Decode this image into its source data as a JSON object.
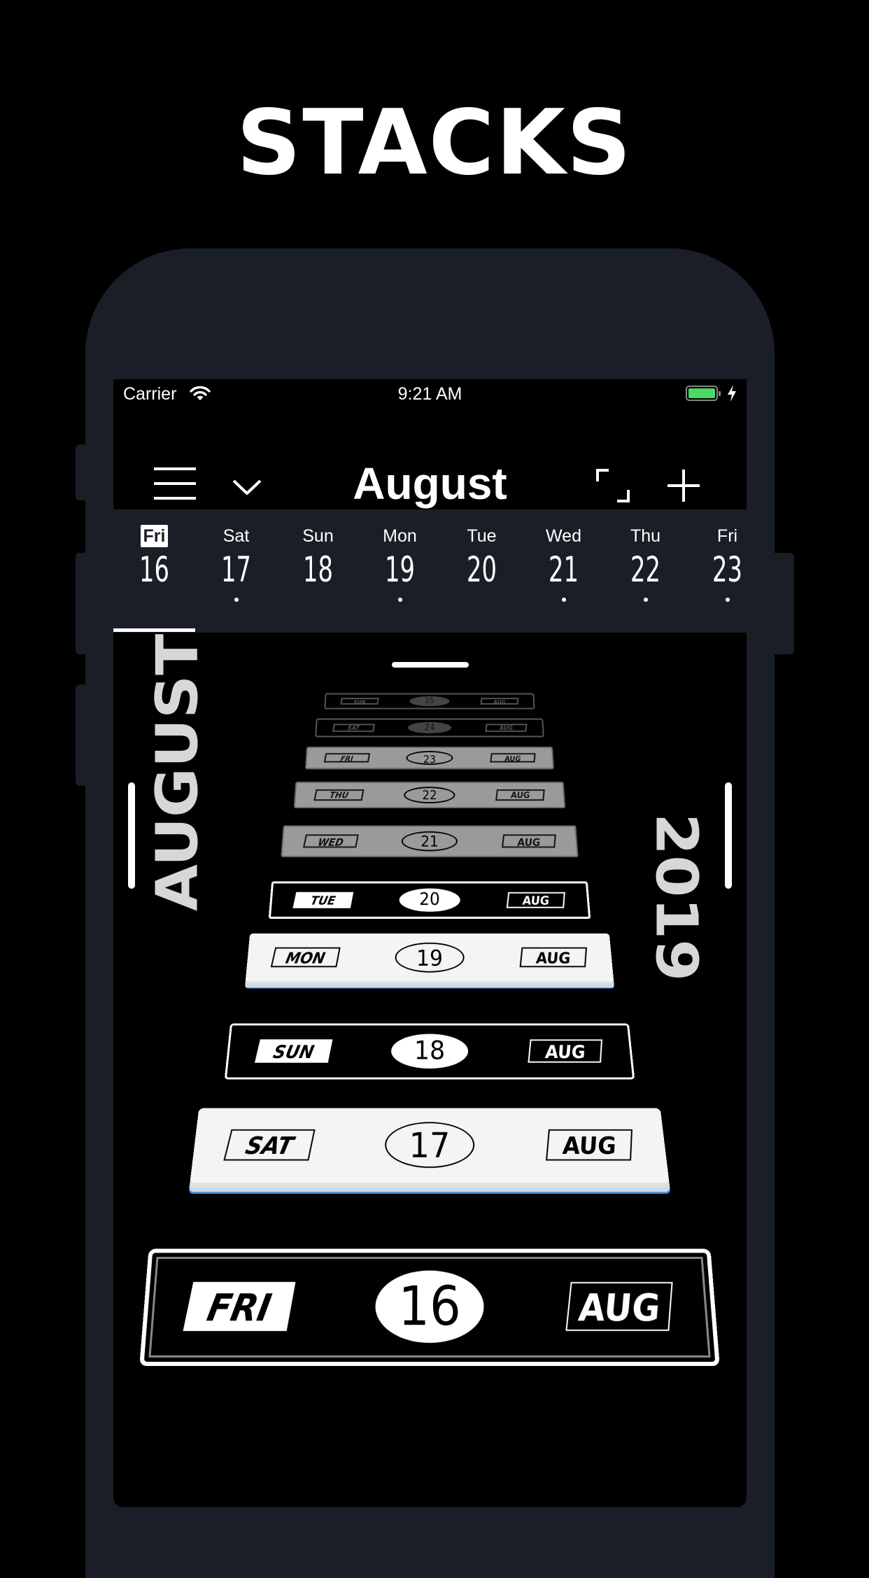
{
  "headline": "STACKS",
  "status": {
    "carrier": "Carrier",
    "time": "9:21 AM"
  },
  "nav": {
    "title": "August",
    "icons": [
      "menu-icon",
      "chevron-down-icon",
      "expand-icon",
      "plus-icon"
    ]
  },
  "date_strip": {
    "days": [
      {
        "name": "Fri",
        "num": "16",
        "selected": true,
        "dot": false
      },
      {
        "name": "Sat",
        "num": "17",
        "selected": false,
        "dot": true
      },
      {
        "name": "Sun",
        "num": "18",
        "selected": false,
        "dot": false
      },
      {
        "name": "Mon",
        "num": "19",
        "selected": false,
        "dot": true
      },
      {
        "name": "Tue",
        "num": "20",
        "selected": false,
        "dot": false
      },
      {
        "name": "Wed",
        "num": "21",
        "selected": false,
        "dot": true
      },
      {
        "name": "Thu",
        "num": "22",
        "selected": false,
        "dot": true
      },
      {
        "name": "Fri",
        "num": "23",
        "selected": false,
        "dot": true
      }
    ]
  },
  "stack": {
    "month_side": "AUGUST",
    "year_side": "2019",
    "cards": [
      {
        "day": "SUN",
        "num": "25",
        "month": "AUG",
        "style": "ghost"
      },
      {
        "day": "SAT",
        "num": "24",
        "month": "AUG",
        "style": "ghost"
      },
      {
        "day": "FRI",
        "num": "23",
        "month": "AUG",
        "style": "grey"
      },
      {
        "day": "THU",
        "num": "22",
        "month": "AUG",
        "style": "grey"
      },
      {
        "day": "WED",
        "num": "21",
        "month": "AUG",
        "style": "grey"
      },
      {
        "day": "TUE",
        "num": "20",
        "month": "AUG",
        "style": "dark"
      },
      {
        "day": "MON",
        "num": "19",
        "month": "AUG",
        "style": "light"
      },
      {
        "day": "SUN",
        "num": "18",
        "month": "AUG",
        "style": "dark"
      },
      {
        "day": "SAT",
        "num": "17",
        "month": "AUG",
        "style": "light"
      },
      {
        "day": "FRI",
        "num": "16",
        "month": "AUG",
        "style": "dark-bold"
      }
    ]
  }
}
